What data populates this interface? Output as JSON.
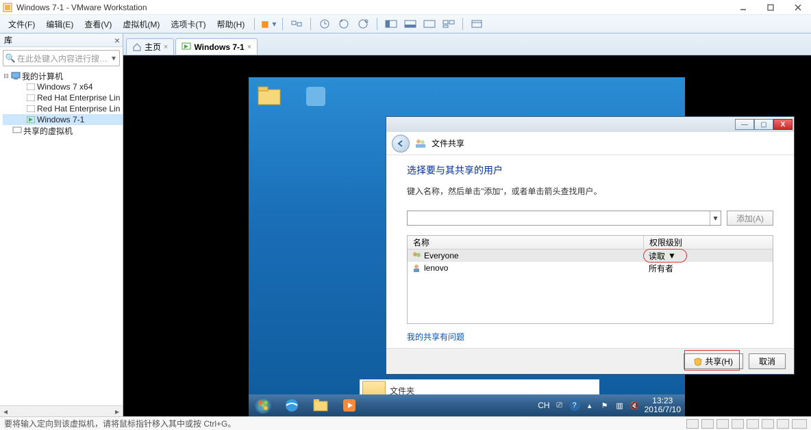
{
  "titlebar": {
    "title": "Windows 7-1 - VMware Workstation"
  },
  "menubar": {
    "items": [
      "文件(F)",
      "编辑(E)",
      "查看(V)",
      "虚拟机(M)",
      "选项卡(T)",
      "帮助(H)"
    ]
  },
  "library": {
    "header": "库",
    "search_placeholder": "在此处键入内容进行搜…",
    "root": "我的计算机",
    "vms": [
      "Windows 7 x64",
      "Red Hat Enterprise Lin",
      "Red Hat Enterprise Lin",
      "Windows 7-1"
    ],
    "shared": "共享的虚拟机"
  },
  "tabs": {
    "home": "主页",
    "vm": "Windows 7-1"
  },
  "share_dialog": {
    "window_title": "文件共享",
    "heading": "选择要与其共享的用户",
    "subtext": "键入名称，然后单击\"添加\"，或者单击箭头查找用户。",
    "add_button": "添加(A)",
    "col_name": "名称",
    "col_perm": "权限级别",
    "rows": [
      {
        "name": "Everyone",
        "perm": "读取",
        "has_dropdown": true
      },
      {
        "name": "lenovo",
        "perm": "所有者",
        "has_dropdown": false
      }
    ],
    "help_link": "我的共享有问题",
    "share_button": "共享(H)",
    "cancel_button": "取消"
  },
  "folder_below": "文件夹",
  "taskbar": {
    "ime": "CH",
    "time": "13:23",
    "date": "2016/7/10"
  },
  "statusbar": {
    "text": "要将输入定向到该虚拟机，请将鼠标指针移入其中或按 Ctrl+G。"
  }
}
